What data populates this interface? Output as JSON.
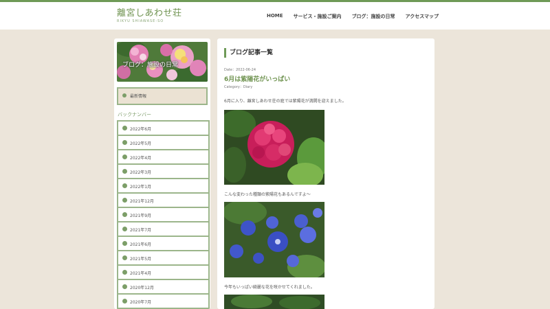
{
  "site": {
    "title": "離宮しあわせ荘",
    "subtitle": "RIKYU SHIAWASE-SO"
  },
  "nav": {
    "items": [
      {
        "label": "HOME"
      },
      {
        "label": "サービス・施設ご案内"
      },
      {
        "label": "ブログ：施設の日常"
      },
      {
        "label": "アクセスマップ"
      }
    ]
  },
  "sidebar": {
    "banner_title": "ブログ：施設の日常",
    "latest_label": "最新情報",
    "backnumber_heading": "バックナンバー",
    "archives": [
      {
        "label": "2022年6月"
      },
      {
        "label": "2022年5月"
      },
      {
        "label": "2022年4月"
      },
      {
        "label": "2022年3月"
      },
      {
        "label": "2022年1月"
      },
      {
        "label": "2021年12月"
      },
      {
        "label": "2021年9月"
      },
      {
        "label": "2021年7月"
      },
      {
        "label": "2021年6月"
      },
      {
        "label": "2021年5月"
      },
      {
        "label": "2021年4月"
      },
      {
        "label": "2020年12月"
      },
      {
        "label": "2020年7月"
      }
    ]
  },
  "main": {
    "heading": "ブログ記事一覧",
    "post": {
      "date": "Date：2022-06-24",
      "title": "6月は紫陽花がいっぱい",
      "category": "Category：Diary",
      "para1": "6月に入り、離宮しあわせ荘の庭では紫陽花が満開を迎えました。",
      "para2": "こんな変わった種類の紫陽花もあるんですよ～",
      "para3": "今年もいっぱい綺麗な花を咲かせてくれました。"
    }
  },
  "colors": {
    "accent": "#6e9a57",
    "page_background": "#ece5da",
    "title_green": "#6f9350"
  }
}
